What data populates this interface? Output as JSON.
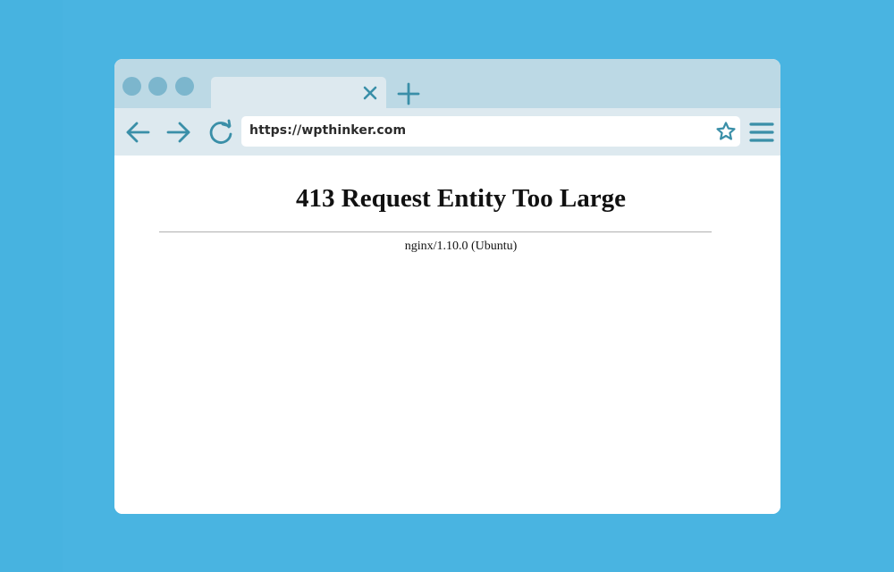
{
  "window": {
    "traffic_lights": [
      "close",
      "minimize",
      "maximize"
    ],
    "tab": {
      "close_icon": "close-icon"
    },
    "new_tab_icon": "plus-icon"
  },
  "toolbar": {
    "back_icon": "arrow-left-icon",
    "forward_icon": "arrow-right-icon",
    "reload_icon": "reload-icon",
    "url": "https://wpthinker.com",
    "bookmark_icon": "star-icon",
    "menu_icon": "hamburger-menu-icon"
  },
  "page": {
    "heading": "413 Request Entity Too Large",
    "server_signature": "nginx/1.10.0 (Ubuntu)"
  },
  "colors": {
    "background": "#49b4e1",
    "chrome": "#bcd9e5",
    "toolbar": "#dde9ef",
    "icon": "#3a8fa8",
    "traffic_light": "#7cb6cd"
  }
}
